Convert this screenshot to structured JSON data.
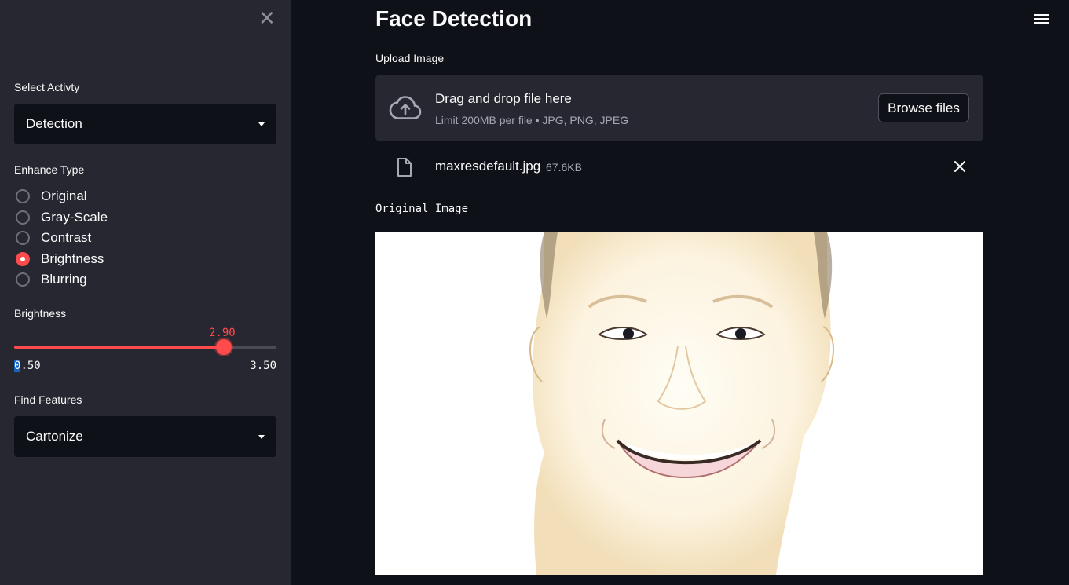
{
  "sidebar": {
    "activity_label": "Select Activty",
    "activity_value": "Detection",
    "enhance_label": "Enhance Type",
    "enhance_options": [
      {
        "label": "Original",
        "selected": false
      },
      {
        "label": "Gray-Scale",
        "selected": false
      },
      {
        "label": "Contrast",
        "selected": false
      },
      {
        "label": "Brightness",
        "selected": true
      },
      {
        "label": "Blurring",
        "selected": false
      }
    ],
    "brightness": {
      "label": "Brightness",
      "value": "2.90",
      "min": "0.50",
      "max": "3.50",
      "fraction": 0.8
    },
    "features_label": "Find Features",
    "features_value": "Cartonize"
  },
  "main": {
    "title": "Face Detection",
    "upload_label": "Upload Image",
    "dropzone": {
      "title": "Drag and drop file here",
      "subtitle": "Limit 200MB per file • JPG, PNG, JPEG",
      "button": "Browse files"
    },
    "file": {
      "name": "maxresdefault.jpg",
      "size": "67.6KB"
    },
    "image_caption": "Original Image"
  },
  "colors": {
    "accent": "#ff4b4b",
    "background": "#0e1117",
    "sidebar": "#262730"
  }
}
